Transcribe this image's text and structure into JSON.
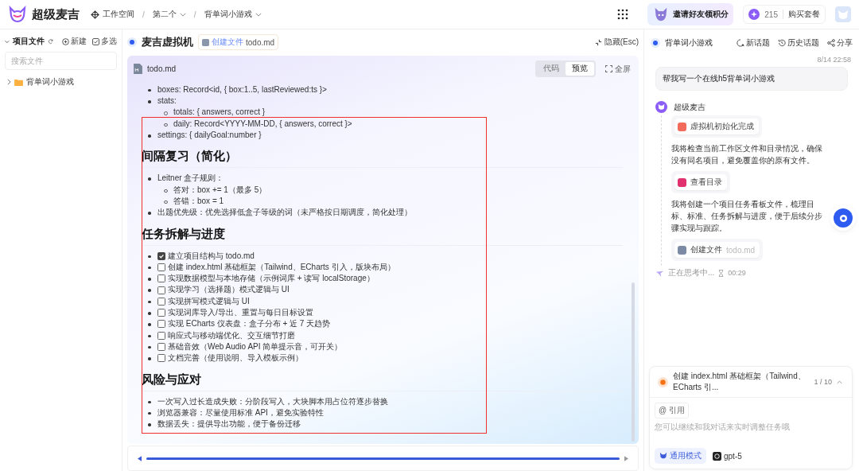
{
  "topbar": {
    "brand": "超级麦吉",
    "breadcrumbs": [
      {
        "label": "工作空间",
        "kind": "root"
      },
      {
        "label": "第二个",
        "kind": "dropdown"
      },
      {
        "label": "背单词小游戏",
        "kind": "dropdown"
      }
    ],
    "separator": "/",
    "invite": "邀请好友领积分",
    "points": "215",
    "buy": "购买套餐"
  },
  "sidebar": {
    "title": "项目文件",
    "actions": [
      {
        "label": "新建",
        "kind": "new"
      },
      {
        "label": "多选",
        "kind": "select"
      }
    ],
    "search": {
      "placeholder": "搜索文件"
    },
    "tree": [
      {
        "label": "背单词小游戏",
        "expanded": false
      }
    ]
  },
  "workspace": {
    "title": "麦吉虚拟机",
    "chip": {
      "action": "创建文件",
      "file": "todo.md"
    },
    "hide": "隐藏(Esc)",
    "doc": {
      "file_name": "todo.md",
      "view_tabs": [
        {
          "label": "代码",
          "selected": false
        },
        {
          "label": "预览",
          "selected": true
        }
      ],
      "fullscreen": "全屏",
      "blocks": [
        {
          "kind": "list",
          "items": [
            {
              "text": "boxes: Record<id, { box:1..5, lastReviewed:ts }>"
            },
            {
              "text": "stats:",
              "children": [
                {
                  "text": "totals: { answers, correct }"
                },
                {
                  "text": "daily: Record<YYYY-MM-DD, { answers, correct }>"
                }
              ]
            },
            {
              "text": "settings: { dailyGoal:number }"
            }
          ]
        },
        {
          "kind": "heading",
          "text": "间隔复习（简化）"
        },
        {
          "kind": "list",
          "items": [
            {
              "text": "Leitner 盒子规则：",
              "children": [
                {
                  "text": "答对：box += 1（最多 5）"
                },
                {
                  "text": "答错：box = 1"
                }
              ]
            },
            {
              "text": "出题优先级：优先选择低盒子等级的词（未严格按日期调度，简化处理）"
            }
          ]
        },
        {
          "kind": "heading",
          "text": "任务拆解与进度"
        },
        {
          "kind": "tasks",
          "items": [
            {
              "text": "建立项目结构与 todo.md",
              "checked": true
            },
            {
              "text": "创建 index.html 基础框架（Tailwind、ECharts 引入，版块布局）",
              "checked": false
            },
            {
              "text": "实现数据模型与本地存储（示例词库 + 读写 localStorage）",
              "checked": false
            },
            {
              "text": "实现学习（选择题）模式逻辑与 UI",
              "checked": false
            },
            {
              "text": "实现拼写模式逻辑与 UI",
              "checked": false
            },
            {
              "text": "实现词库导入/导出、重置与每日目标设置",
              "checked": false
            },
            {
              "text": "实现 ECharts 仪表盘：盒子分布 + 近 7 天趋势",
              "checked": false
            },
            {
              "text": "响应式与移动端优化、交互细节打磨",
              "checked": false
            },
            {
              "text": "基础音效（Web Audio API 简单提示音，可开关）",
              "checked": false
            },
            {
              "text": "文档完善（使用说明、导入模板示例）",
              "checked": false
            }
          ]
        },
        {
          "kind": "heading",
          "text": "风险与应对"
        },
        {
          "kind": "list",
          "items": [
            {
              "text": "一次写入过长造成失败：分阶段写入，大块脚本用占位符逐步替换"
            },
            {
              "text": "浏览器兼容：尽量使用标准 API，避免实验特性"
            },
            {
              "text": "数据丢失：提供导出功能，便于备份迁移"
            }
          ]
        }
      ]
    }
  },
  "chat": {
    "title": "背单词小游戏",
    "actions": [
      {
        "label": "新话题",
        "kind": "new"
      },
      {
        "label": "历史话题",
        "kind": "history"
      },
      {
        "label": "分享",
        "kind": "share"
      }
    ],
    "time": "8/14 22:58",
    "user_message": "帮我写一个在线h5背单词小游戏",
    "bot_name": "超级麦吉",
    "steps": [
      {
        "kind": "tool",
        "label": "虚拟机初始化完成",
        "color": "#f26b5b"
      },
      {
        "kind": "text",
        "text": "我将检查当前工作区文件和目录情况，确保没有同名项目，避免覆盖你的原有文件。"
      },
      {
        "kind": "tool",
        "label": "查看目录",
        "color": "#e0306e"
      },
      {
        "kind": "text",
        "text": "我将创建一个项目任务看板文件，梳理目标、标准、任务拆解与进度，便于后续分步骤实现与跟踪。"
      },
      {
        "kind": "tool",
        "label": "创建文件",
        "file": "todo.md",
        "color": "#7d8aa6"
      }
    ],
    "thinking": "正在思考中...",
    "timer": "00:29",
    "composer": {
      "task": "创建 index.html 基础框架（Tailwind、ECharts 引...",
      "progress": "1 / 10",
      "quote": "@ 引用",
      "placeholder": "您可以继续和我对话来实时调整任务哦",
      "mode": "通用模式",
      "model": "gpt-5"
    }
  }
}
